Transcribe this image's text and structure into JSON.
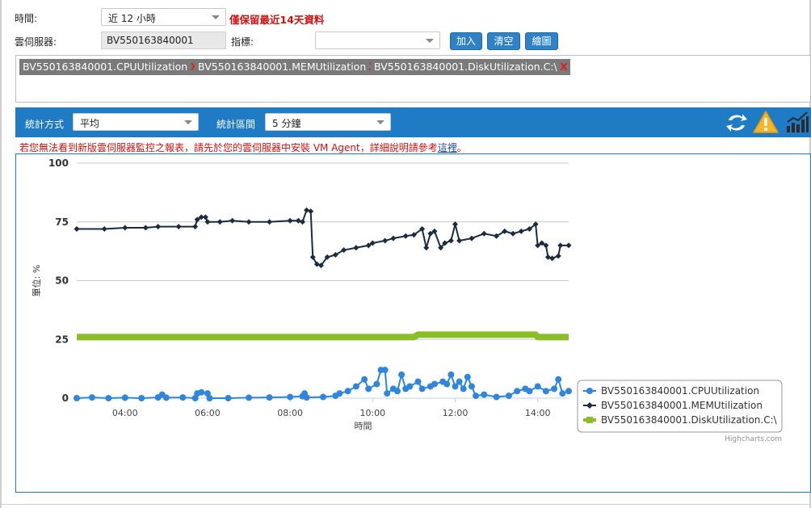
{
  "filters": {
    "time_label": "時間:",
    "time_value": "近 12 小時",
    "time_note": "僅保留最近14天資料",
    "server_label": "雲伺服器:",
    "server_value": "BV550163840001",
    "metric_label": "指標:",
    "metric_value": "",
    "add_label": "加入",
    "clear_label": "清空",
    "plot_label": "繪圖"
  },
  "tags": [
    {
      "label": "BV550163840001.CPUUtilization",
      "remove": "X"
    },
    {
      "label": "BV550163840001.MEMUtilization",
      "remove": "X"
    },
    {
      "label": "BV550163840001.DiskUtilization.C:\\",
      "remove": "X"
    }
  ],
  "toolbar": {
    "stat_method_label": "統計方式",
    "stat_method_value": "平均",
    "stat_interval_label": "統計區間",
    "stat_interval_value": "5 分鐘"
  },
  "notice": {
    "text": "若您無法看到新版雲伺服器監控之報表，請先於您的雲伺服器中安裝 VM Agent，詳細說明請參考",
    "link": "這裡",
    "suffix": "。"
  },
  "chart_data": {
    "type": "line",
    "title": "",
    "xlabel": "時間",
    "ylabel": "單位: %",
    "ylim": [
      0,
      100
    ],
    "yticks": [
      "0",
      "25",
      "50",
      "75",
      "100"
    ],
    "xticks": [
      "04:00",
      "06:00",
      "08:00",
      "10:00",
      "12:00",
      "14:00"
    ],
    "xlim_hours": [
      2.83,
      14.75
    ],
    "legend_position": "right-bottom",
    "credit": "Highcharts.com",
    "colors": {
      "cpu": "#2e86de",
      "mem": "#1b2c40",
      "disk": "#8bbd24"
    },
    "series": [
      {
        "name": "BV550163840001.CPUUtilization",
        "points": [
          [
            2.83,
            0
          ],
          [
            3.2,
            0.3
          ],
          [
            3.6,
            0
          ],
          [
            4.0,
            0.2
          ],
          [
            4.4,
            0
          ],
          [
            4.8,
            0.3
          ],
          [
            4.9,
            1.5
          ],
          [
            5.0,
            0.2
          ],
          [
            5.4,
            0.3
          ],
          [
            5.7,
            0
          ],
          [
            5.75,
            2
          ],
          [
            5.85,
            2.5
          ],
          [
            6.0,
            2
          ],
          [
            6.05,
            0
          ],
          [
            6.5,
            0
          ],
          [
            7.0,
            0.2
          ],
          [
            7.5,
            0.3
          ],
          [
            8.0,
            0.5
          ],
          [
            8.3,
            0.8
          ],
          [
            8.35,
            2
          ],
          [
            8.4,
            0.3
          ],
          [
            8.8,
            0.5
          ],
          [
            9.1,
            1
          ],
          [
            9.2,
            2
          ],
          [
            9.4,
            3
          ],
          [
            9.6,
            5
          ],
          [
            9.8,
            8
          ],
          [
            9.9,
            4
          ],
          [
            10.1,
            6
          ],
          [
            10.2,
            12
          ],
          [
            10.3,
            12
          ],
          [
            10.35,
            2
          ],
          [
            10.5,
            4
          ],
          [
            10.6,
            3
          ],
          [
            10.7,
            10
          ],
          [
            10.8,
            4
          ],
          [
            10.9,
            5
          ],
          [
            11.1,
            7
          ],
          [
            11.2,
            4
          ],
          [
            11.4,
            5
          ],
          [
            11.5,
            6
          ],
          [
            11.7,
            7
          ],
          [
            11.8,
            6
          ],
          [
            11.9,
            10
          ],
          [
            12.0,
            5
          ],
          [
            12.1,
            7
          ],
          [
            12.2,
            4
          ],
          [
            12.3,
            9
          ],
          [
            12.4,
            5
          ],
          [
            12.5,
            1
          ],
          [
            12.7,
            1.5
          ],
          [
            13.0,
            0.5
          ],
          [
            13.3,
            1
          ],
          [
            13.5,
            3
          ],
          [
            13.7,
            4
          ],
          [
            13.8,
            3
          ],
          [
            14.0,
            5
          ],
          [
            14.2,
            3
          ],
          [
            14.4,
            4
          ],
          [
            14.5,
            8
          ],
          [
            14.6,
            2
          ],
          [
            14.75,
            3
          ]
        ]
      },
      {
        "name": "BV550163840001.MEMUtilization",
        "points": [
          [
            2.83,
            72
          ],
          [
            3.5,
            72
          ],
          [
            4.0,
            72.5
          ],
          [
            4.5,
            72.5
          ],
          [
            4.8,
            73
          ],
          [
            5.3,
            73
          ],
          [
            5.7,
            73
          ],
          [
            5.75,
            76
          ],
          [
            5.85,
            77
          ],
          [
            5.95,
            77
          ],
          [
            6.0,
            75
          ],
          [
            6.3,
            75
          ],
          [
            6.6,
            75.5
          ],
          [
            7.0,
            75
          ],
          [
            7.5,
            75
          ],
          [
            8.0,
            75.5
          ],
          [
            8.2,
            75.5
          ],
          [
            8.3,
            75
          ],
          [
            8.4,
            80
          ],
          [
            8.5,
            79.5
          ],
          [
            8.55,
            60
          ],
          [
            8.65,
            57
          ],
          [
            8.75,
            56.5
          ],
          [
            8.9,
            60
          ],
          [
            9.1,
            61
          ],
          [
            9.3,
            63
          ],
          [
            9.6,
            64
          ],
          [
            9.9,
            65
          ],
          [
            10.0,
            66
          ],
          [
            10.3,
            67
          ],
          [
            10.5,
            68
          ],
          [
            10.8,
            69
          ],
          [
            11.0,
            69.5
          ],
          [
            11.2,
            72
          ],
          [
            11.3,
            64
          ],
          [
            11.4,
            70
          ],
          [
            11.5,
            71
          ],
          [
            11.65,
            64
          ],
          [
            11.75,
            66
          ],
          [
            11.9,
            67
          ],
          [
            12.0,
            74
          ],
          [
            12.1,
            67
          ],
          [
            12.4,
            68
          ],
          [
            12.7,
            70
          ],
          [
            13.0,
            69
          ],
          [
            13.2,
            71
          ],
          [
            13.4,
            70
          ],
          [
            13.6,
            71
          ],
          [
            13.8,
            72
          ],
          [
            13.95,
            74
          ],
          [
            14.0,
            65
          ],
          [
            14.1,
            66
          ],
          [
            14.2,
            65
          ],
          [
            14.25,
            60
          ],
          [
            14.35,
            59.5
          ],
          [
            14.5,
            60.5
          ],
          [
            14.55,
            65
          ],
          [
            14.75,
            65
          ]
        ]
      },
      {
        "name": "BV550163840001.DiskUtilization.C:\\",
        "points": [
          [
            2.83,
            26
          ],
          [
            11.0,
            26
          ],
          [
            11.1,
            27
          ],
          [
            13.95,
            27
          ],
          [
            14.0,
            26
          ],
          [
            14.75,
            26
          ]
        ]
      }
    ]
  }
}
